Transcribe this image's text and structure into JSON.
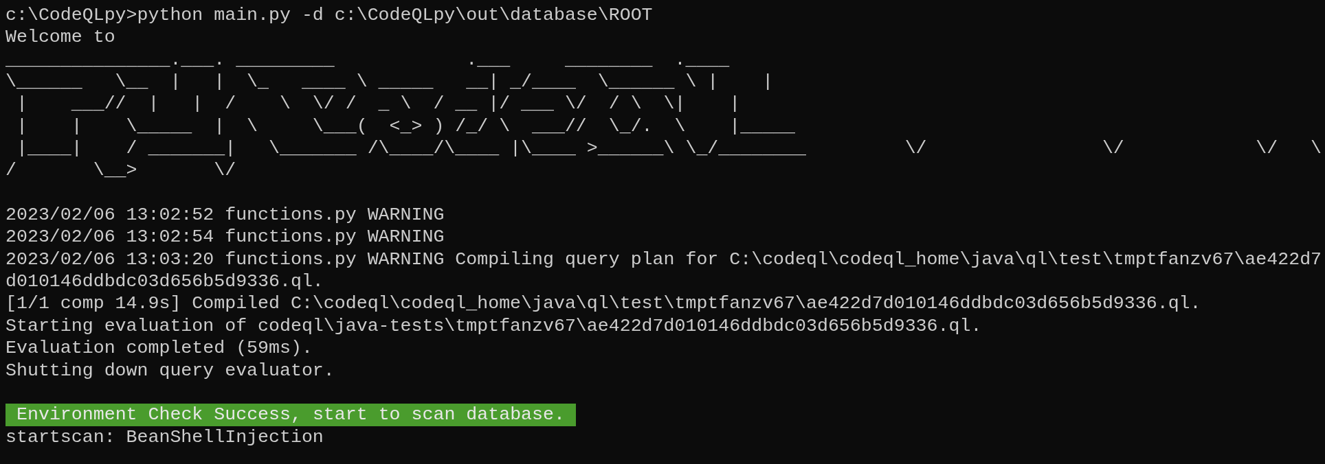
{
  "terminal": {
    "lines": [
      {
        "kind": "text",
        "text": "c:\\CodeQLpy>python main.py -d c:\\CodeQLpy\\out\\database\\ROOT"
      },
      {
        "kind": "text",
        "text": "Welcome to"
      },
      {
        "kind": "art",
        "text": "_______________.___. _________            .___     ________  .____"
      },
      {
        "kind": "art",
        "text": "\\______   \\__  |   |  \\_   ____ \\ _____   __| _/____  \\______ \\ |    |"
      },
      {
        "kind": "art",
        "text": " |    ___//  |   |  /    \\  \\/ /  _ \\  / __ |/ ___ \\/  / \\  \\|    |"
      },
      {
        "kind": "art",
        "text": " |    |    \\_____  |  \\     \\___(  <_> ) /_/ \\  ___//  \\_/.  \\    |_____"
      },
      {
        "kind": "art",
        "text": " |____|    / _______|   \\_______ /\\____/\\____ |\\____ >______\\ \\_/________         \\/                \\/            \\/   \\"
      },
      {
        "kind": "art",
        "text": "/       \\__>       \\/"
      },
      {
        "kind": "blank"
      },
      {
        "kind": "text",
        "text": "2023/02/06 13:02:52 functions.py WARNING"
      },
      {
        "kind": "text",
        "text": "2023/02/06 13:02:54 functions.py WARNING"
      },
      {
        "kind": "text",
        "text": "2023/02/06 13:03:20 functions.py WARNING Compiling query plan for C:\\codeql\\codeql_home\\java\\ql\\test\\tmptfanzv67\\ae422d7"
      },
      {
        "kind": "text",
        "text": "d010146ddbdc03d656b5d9336.ql."
      },
      {
        "kind": "text",
        "text": "[1/1 comp 14.9s] Compiled C:\\codeql\\codeql_home\\java\\ql\\test\\tmptfanzv67\\ae422d7d010146ddbdc03d656b5d9336.ql."
      },
      {
        "kind": "text",
        "text": "Starting evaluation of codeql\\java-tests\\tmptfanzv67\\ae422d7d010146ddbdc03d656b5d9336.ql."
      },
      {
        "kind": "text",
        "text": "Evaluation completed (59ms)."
      },
      {
        "kind": "text",
        "text": "Shutting down query evaluator."
      },
      {
        "kind": "blank"
      },
      {
        "kind": "highlight",
        "text": "Environment Check Success, start to scan database."
      },
      {
        "kind": "text",
        "text": "startscan: BeanShellInjection"
      }
    ]
  }
}
